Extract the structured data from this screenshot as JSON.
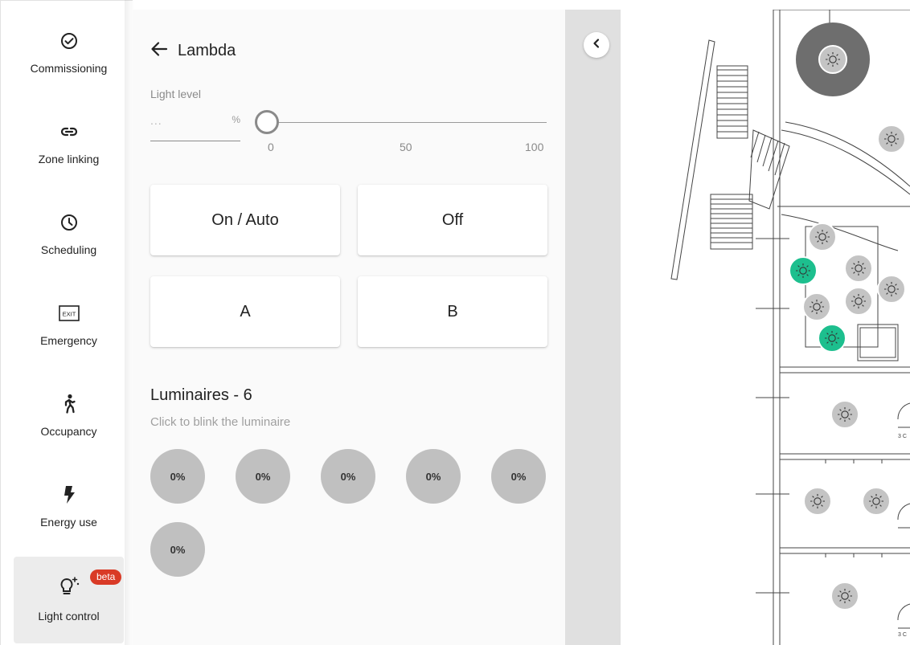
{
  "nav": {
    "items": [
      {
        "label": "Commissioning",
        "icon": "check-circle-icon"
      },
      {
        "label": "Zone linking",
        "icon": "link-icon"
      },
      {
        "label": "Scheduling",
        "icon": "clock-icon"
      },
      {
        "label": "Emergency",
        "icon": "exit-sign-icon",
        "icon_text": "EXIT"
      },
      {
        "label": "Occupancy",
        "icon": "walking-person-icon"
      },
      {
        "label": "Energy use",
        "icon": "lightning-icon"
      },
      {
        "label": "Light control",
        "icon": "bulb-sparkle-icon",
        "badge": "beta",
        "active": true
      }
    ]
  },
  "panel": {
    "title": "Lambda",
    "light_level": {
      "label": "Light level",
      "placeholder": "...",
      "unit": "%",
      "slider_min_label": "0",
      "slider_mid_label": "50",
      "slider_max_label": "100",
      "slider_value": 0
    },
    "buttons": {
      "on_auto": "On / Auto",
      "off": "Off",
      "scene_a": "A",
      "scene_b": "B"
    },
    "luminaires": {
      "title": "Luminaires - 6",
      "subtitle": "Click to blink the luminaire",
      "items": [
        "0%",
        "0%",
        "0%",
        "0%",
        "0%",
        "0%"
      ]
    }
  },
  "map": {
    "room_labels": [
      "3 C",
      "3 C"
    ],
    "colors": {
      "active": "#1dbf8e",
      "inactive": "#c4c4c4",
      "selected_zone": "#6e6e6e"
    }
  },
  "colors": {
    "beta_badge": "#d93a26",
    "rail_active_bg": "#ececec",
    "panel_bg": "#fafafa",
    "strip_bg": "#e0e0e0"
  }
}
